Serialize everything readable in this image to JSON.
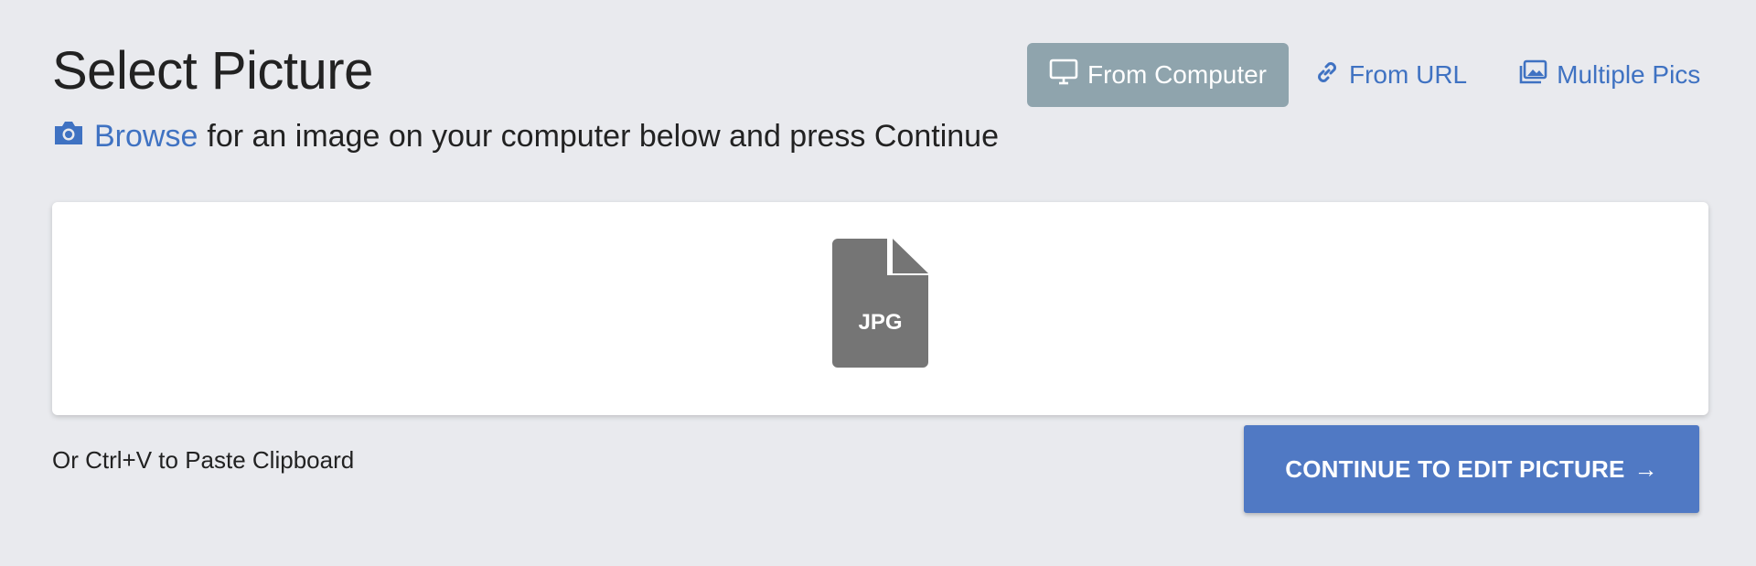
{
  "header": {
    "title": "Select Picture"
  },
  "source_tabs": [
    {
      "label": "From Computer",
      "icon": "monitor-icon",
      "active": true
    },
    {
      "label": "From URL",
      "icon": "link-icon",
      "active": false
    },
    {
      "label": "Multiple Pics",
      "icon": "images-icon",
      "active": false
    }
  ],
  "instruction": {
    "icon": "camera-icon",
    "browse_link": "Browse",
    "text": "for an image on your computer below and press Continue"
  },
  "dropzone": {
    "icon": "jpg-file-icon",
    "file_label": "JPG"
  },
  "paste_hint": "Or Ctrl+V to Paste Clipboard",
  "continue_button": {
    "label": "CONTINUE TO EDIT PICTURE",
    "arrow": "→"
  },
  "colors": {
    "background": "#e9eaee",
    "link": "#3f72c2",
    "active_tab": "#8fa4ad",
    "primary_button": "#5079c4",
    "file_icon": "#757575"
  }
}
